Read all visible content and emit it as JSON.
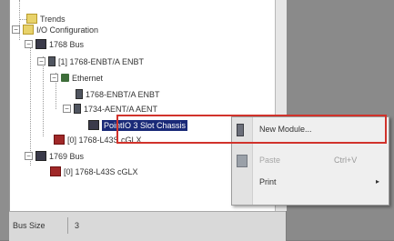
{
  "tree": {
    "trends": "Trends",
    "io_config": "I/O Configuration",
    "bus_1768": "1768 Bus",
    "enbt_slot": "[1] 1768-ENBT/A ENBT",
    "ethernet": "Ethernet",
    "enbt": "1768-ENBT/A ENBT",
    "aent": "1734-AENT/A AENT",
    "pointio": "PointIO 3 Slot Chassis",
    "l43_slot": "[0] 1768-L43S cGLX",
    "bus_1769": "1769 Bus",
    "l43_1769": "[0] 1768-L43S cGLX"
  },
  "context_menu": {
    "new_module": "New Module...",
    "paste": "Paste",
    "paste_shortcut": "Ctrl+V",
    "print": "Print",
    "print_arrow": "▸"
  },
  "status": {
    "label": "Bus Size",
    "value": "3"
  },
  "colors": {
    "selection": "#1a2a78",
    "highlight_border": "#d1322b"
  }
}
